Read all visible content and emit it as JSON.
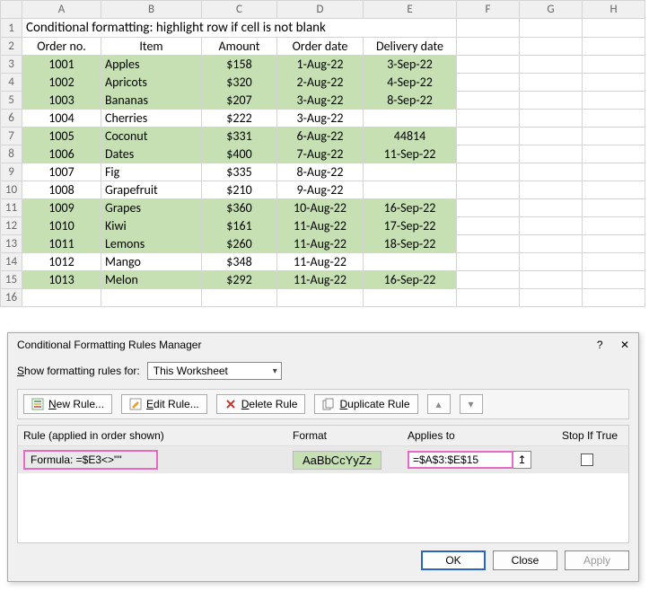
{
  "sheet": {
    "col_letters": [
      "A",
      "B",
      "C",
      "D",
      "E",
      "F",
      "G",
      "H"
    ],
    "title": "Conditional formatting: highlight row if cell is not blank",
    "headers": {
      "A": "Order no.",
      "B": "Item",
      "C": "Amount",
      "D": "Order date",
      "E": "Delivery date"
    },
    "rows": [
      {
        "n": 3,
        "hl": true,
        "A": "1001",
        "B": "Apples",
        "C": "$158",
        "D": "1-Aug-22",
        "E": "3-Sep-22"
      },
      {
        "n": 4,
        "hl": true,
        "A": "1002",
        "B": "Apricots",
        "C": "$320",
        "D": "2-Aug-22",
        "E": "4-Sep-22"
      },
      {
        "n": 5,
        "hl": true,
        "A": "1003",
        "B": "Bananas",
        "C": "$207",
        "D": "3-Aug-22",
        "E": "8-Sep-22"
      },
      {
        "n": 6,
        "hl": false,
        "A": "1004",
        "B": "Cherries",
        "C": "$222",
        "D": "3-Aug-22",
        "E": ""
      },
      {
        "n": 7,
        "hl": true,
        "A": "1005",
        "B": "Coconut",
        "C": "$331",
        "D": "6-Aug-22",
        "E": "44814"
      },
      {
        "n": 8,
        "hl": true,
        "A": "1006",
        "B": "Dates",
        "C": "$400",
        "D": "7-Aug-22",
        "E": "11-Sep-22"
      },
      {
        "n": 9,
        "hl": false,
        "A": "1007",
        "B": "Fig",
        "C": "$335",
        "D": "8-Aug-22",
        "E": ""
      },
      {
        "n": 10,
        "hl": false,
        "A": "1008",
        "B": "Grapefruit",
        "C": "$210",
        "D": "9-Aug-22",
        "E": ""
      },
      {
        "n": 11,
        "hl": true,
        "A": "1009",
        "B": "Grapes",
        "C": "$360",
        "D": "10-Aug-22",
        "E": "16-Sep-22"
      },
      {
        "n": 12,
        "hl": true,
        "A": "1010",
        "B": "Kiwi",
        "C": "$161",
        "D": "11-Aug-22",
        "E": "17-Sep-22"
      },
      {
        "n": 13,
        "hl": true,
        "A": "1011",
        "B": "Lemons",
        "C": "$260",
        "D": "11-Aug-22",
        "E": "18-Sep-22"
      },
      {
        "n": 14,
        "hl": false,
        "A": "1012",
        "B": "Mango",
        "C": "$348",
        "D": "11-Aug-22",
        "E": ""
      },
      {
        "n": 15,
        "hl": true,
        "A": "1013",
        "B": "Melon",
        "C": "$292",
        "D": "11-Aug-22",
        "E": "16-Sep-22"
      },
      {
        "n": 16,
        "hl": false,
        "A": "",
        "B": "",
        "C": "",
        "D": "",
        "E": ""
      }
    ]
  },
  "dialog": {
    "title": "Conditional Formatting Rules Manager",
    "help_glyph": "?",
    "close_glyph": "✕",
    "show_label_pre": "S",
    "show_label_post": "how formatting rules for:",
    "scope_value": "This Worksheet",
    "toolbar": {
      "new_pre": "N",
      "new_post": "ew Rule...",
      "edit_pre": "E",
      "edit_post": "dit Rule...",
      "delete_pre": "D",
      "delete_post": "elete Rule",
      "dup_pre": "D",
      "dup_post": "uplicate Rule",
      "up_glyph": "▴",
      "down_glyph": "▾"
    },
    "cols": {
      "rule": "Rule (applied in order shown)",
      "format": "Format",
      "applies": "Applies to",
      "stop": "Stop If True"
    },
    "rule": {
      "formula_label": "Formula: =$E3<>\"\"",
      "preview_text": "AaBbCcYyZz",
      "applies_to": "=$A$3:$E$15",
      "range_glyph": "↥"
    },
    "footer": {
      "ok": "OK",
      "close": "Close",
      "apply": "Apply"
    }
  }
}
